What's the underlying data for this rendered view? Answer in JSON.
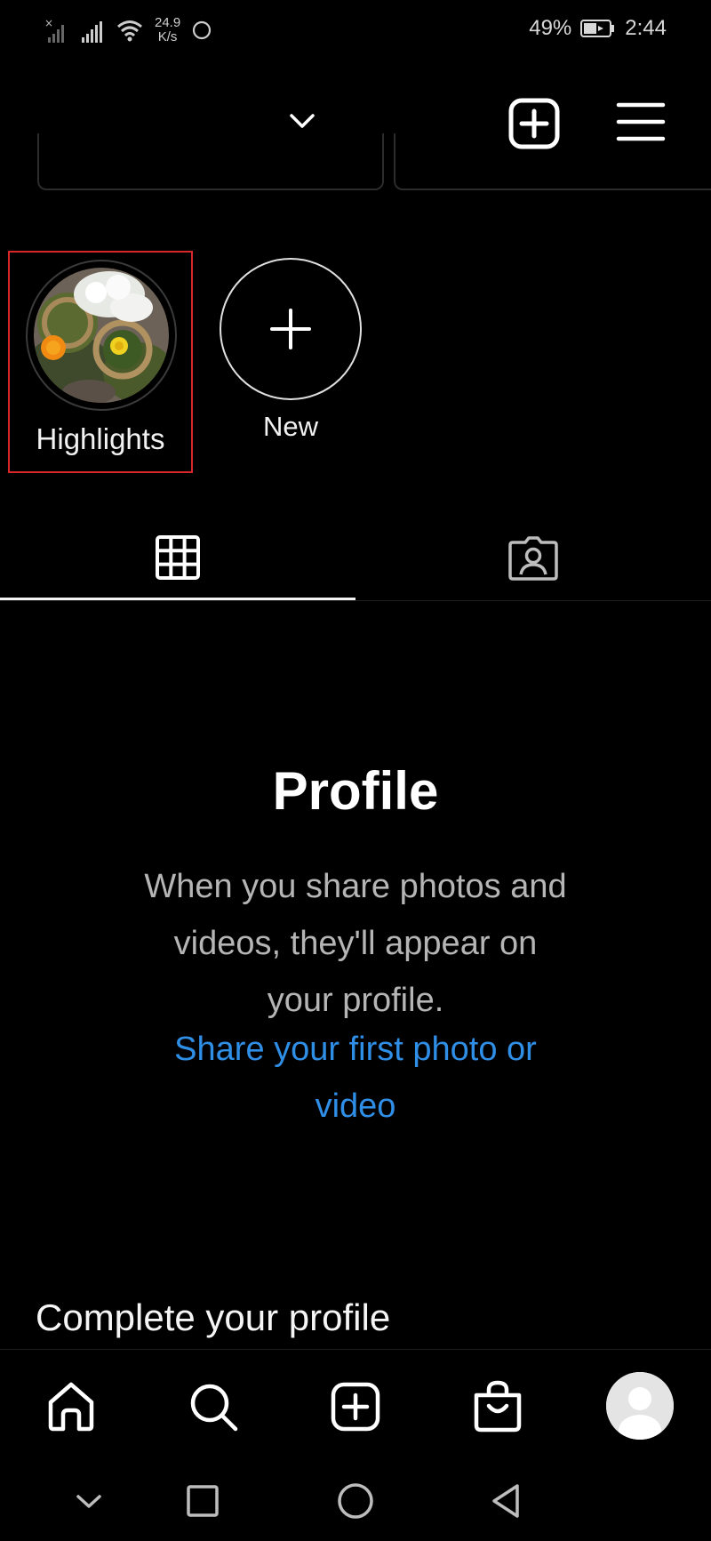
{
  "status_bar": {
    "net_speed_value": "24.9",
    "net_speed_unit": "K/s",
    "battery": "49%",
    "time": "2:44"
  },
  "highlights": {
    "items": [
      {
        "label": "Highlights"
      }
    ],
    "new_label": "New"
  },
  "empty_state": {
    "title": "Profile",
    "body": "When you share photos and videos, they'll appear on your profile.",
    "link": "Share your first photo or video"
  },
  "complete_profile": {
    "heading": "Complete your profile"
  },
  "colors": {
    "background": "#000000",
    "link": "#2f8ee6",
    "highlight_outline": "#d6282b"
  },
  "icons": {
    "header": [
      "chevron-down-icon",
      "add-post-icon",
      "menu-icon"
    ],
    "tabs": [
      "grid-icon",
      "tagged-icon"
    ],
    "bottom_nav": [
      "home-icon",
      "search-icon",
      "create-icon",
      "shop-icon",
      "profile-avatar"
    ],
    "system_nav": [
      "nav-down-icon",
      "recents-icon",
      "home-circle-icon",
      "back-icon"
    ]
  }
}
